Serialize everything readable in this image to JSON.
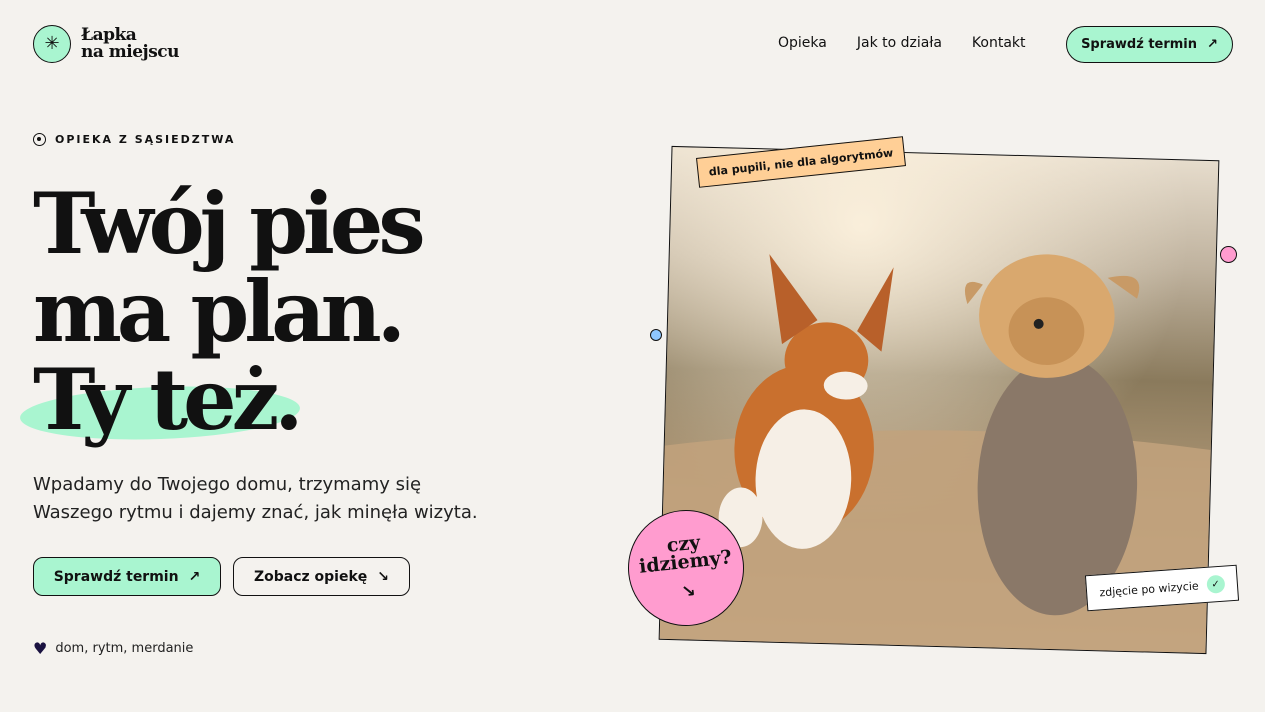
{
  "header": {
    "logo_line1": "Łapka",
    "logo_line2": "na miejscu",
    "logo_icon": "asterisk-icon",
    "nav": [
      {
        "label": "Opieka"
      },
      {
        "label": "Jak to działa"
      },
      {
        "label": "Kontakt"
      }
    ],
    "cta_label": "Sprawdź termin"
  },
  "hero": {
    "eyebrow": "OPIEKA Z SĄSIEDZTWA",
    "headline": [
      "Twój pies",
      "ma plan.",
      "Ty też."
    ],
    "subtitle": [
      "Wpadamy do Twojego domu, trzymamy się",
      "Waszego rytmu i dajemy znać, jak minęła wizyta."
    ],
    "primary_cta": "Sprawdź termin",
    "secondary_cta": "Zobacz opiekę",
    "footnote": "dom, rytm, merdanie"
  },
  "photo": {
    "tag": "dla pupili, nie dla algorytmów",
    "badge_line1": "czy",
    "badge_line2": "idziemy?",
    "caption": "zdjęcie po wizycie"
  },
  "colors": {
    "background": "#f4f2ee",
    "mint": "#a9f5d0",
    "pink": "#ff9ccf",
    "peach": "#ffcf96",
    "blue": "#8ec6ff",
    "ink": "#111111"
  }
}
